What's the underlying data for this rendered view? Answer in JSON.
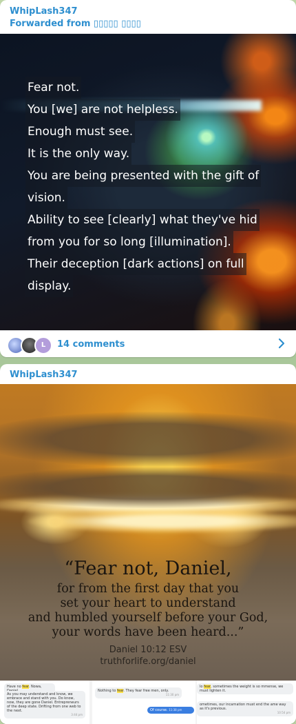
{
  "post1": {
    "sender": "WhipLash347",
    "forwarded_from": "Forwarded from ▯▯▯▯▯ ▯▯▯▯",
    "quote_lines": [
      "Fear not.",
      "You [we] are not helpless.",
      "Enough must see.",
      "It is the only way.",
      "You are being presented with the gift of",
      "vision.",
      "Ability to see [clearly] what they've hid",
      "from you for so long [illumination].",
      "Their deception [dark actions] on full",
      "display."
    ],
    "comments_label": "14 comments",
    "avatar3_letter": "L"
  },
  "post2": {
    "sender": "WhipLash347",
    "quote": {
      "line1": "“Fear not, Daniel,",
      "line2": "for from the first day that you",
      "line3": "set your heart to understand",
      "line4": "and humbled yourself before your God,",
      "line5": "your words have been heard...”",
      "reference": "Daniel 10:12 ESV",
      "site": "truthforlife.org/daniel"
    },
    "chat1": {
      "header_pre": "Have no ",
      "header_hl": "fear",
      "header_post": ". Nowa, Daniel",
      "body": "As you may understand and know, we embrace and stand with you. Do know, now, they are gone Daniel. Entrepreneurs of the deep state. Drifting from one web to the next.",
      "time": "3:44 pm"
    },
    "chat2": {
      "msg_pre": "Nothing to ",
      "msg_hl": "fear",
      "msg_post": ". They fear free men, only.",
      "time1": "11:30 pm",
      "reply": "Of course.",
      "time2": "11:38 pm"
    },
    "chat3": {
      "msg1_pre": "lo ",
      "msg1_hl": "fear",
      "msg1_post": ", sometimes the weight is so mmense, we must lighten it.",
      "msg2": "ometimes, our incarnation must end the ame way as it's previous.",
      "time": "10:54 pm"
    }
  },
  "colors": {
    "accent": "#2e8fcf",
    "chat_wallpaper": "#b6cfa3",
    "highlight": "#ffe24a",
    "outgoing_bubble": "#3a7ee0"
  },
  "icons": {
    "comments_arrow": "chevron-right-icon"
  }
}
